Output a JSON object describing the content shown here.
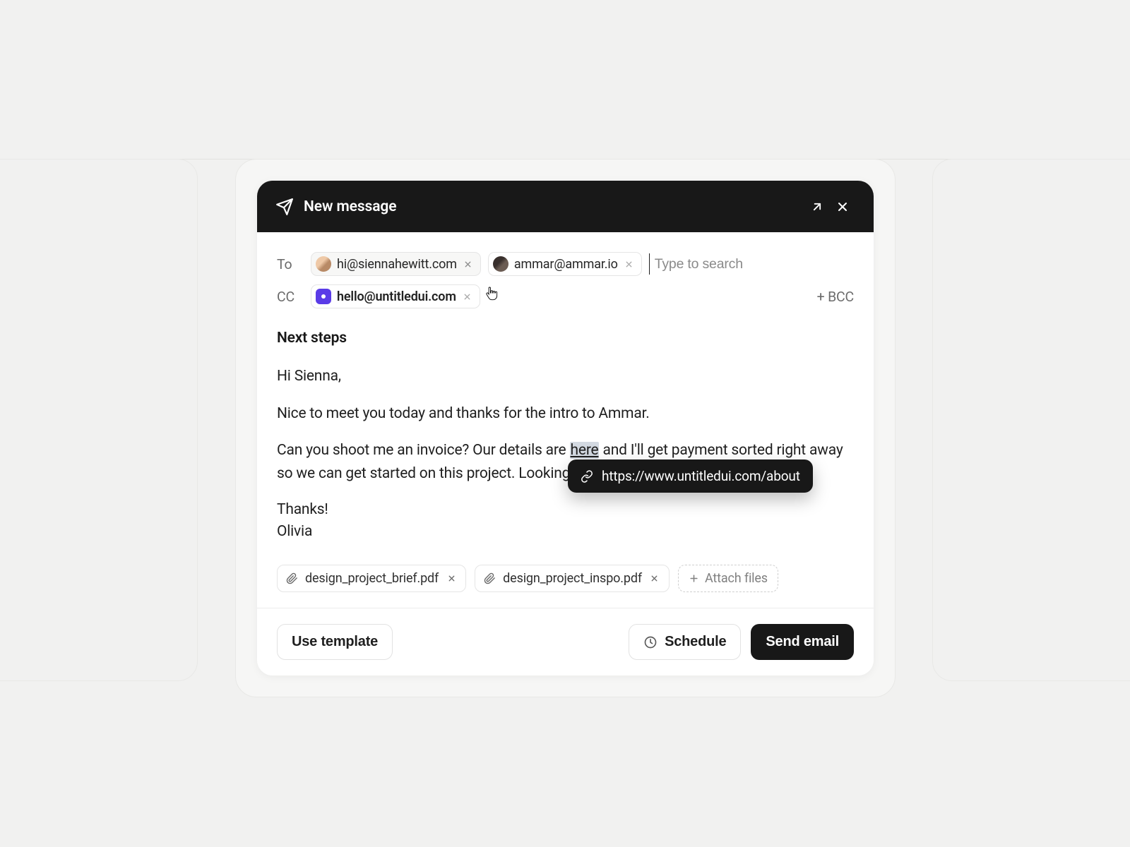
{
  "header": {
    "title": "New message"
  },
  "to": {
    "label": "To",
    "recipients": [
      {
        "email": "hi@siennahewitt.com"
      },
      {
        "email": "ammar@ammar.io"
      }
    ],
    "search_placeholder": "Type to search"
  },
  "cc": {
    "label": "CC",
    "recipients": [
      {
        "email": "hello@untitledui.com"
      }
    ]
  },
  "bcc_button": "+ BCC",
  "subject": "Next steps",
  "body": {
    "greeting": "Hi Sienna,",
    "p1": "Nice to meet you today and thanks for the intro to Ammar.",
    "p2a": "Can you shoot me an invoice? Our details are ",
    "link_text": "here",
    "p2b": " and I'll get payment sorted right away so we can get started on this project. Looking forward to it!",
    "thanks": "Thanks!",
    "signature": "Olivia"
  },
  "link_tooltip": "https://www.untitledui.com/about",
  "attachments": [
    {
      "name": "design_project_brief.pdf"
    },
    {
      "name": "design_project_inspo.pdf"
    }
  ],
  "attach_button": "Attach files",
  "footer": {
    "template": "Use template",
    "schedule": "Schedule",
    "send": "Send email"
  }
}
